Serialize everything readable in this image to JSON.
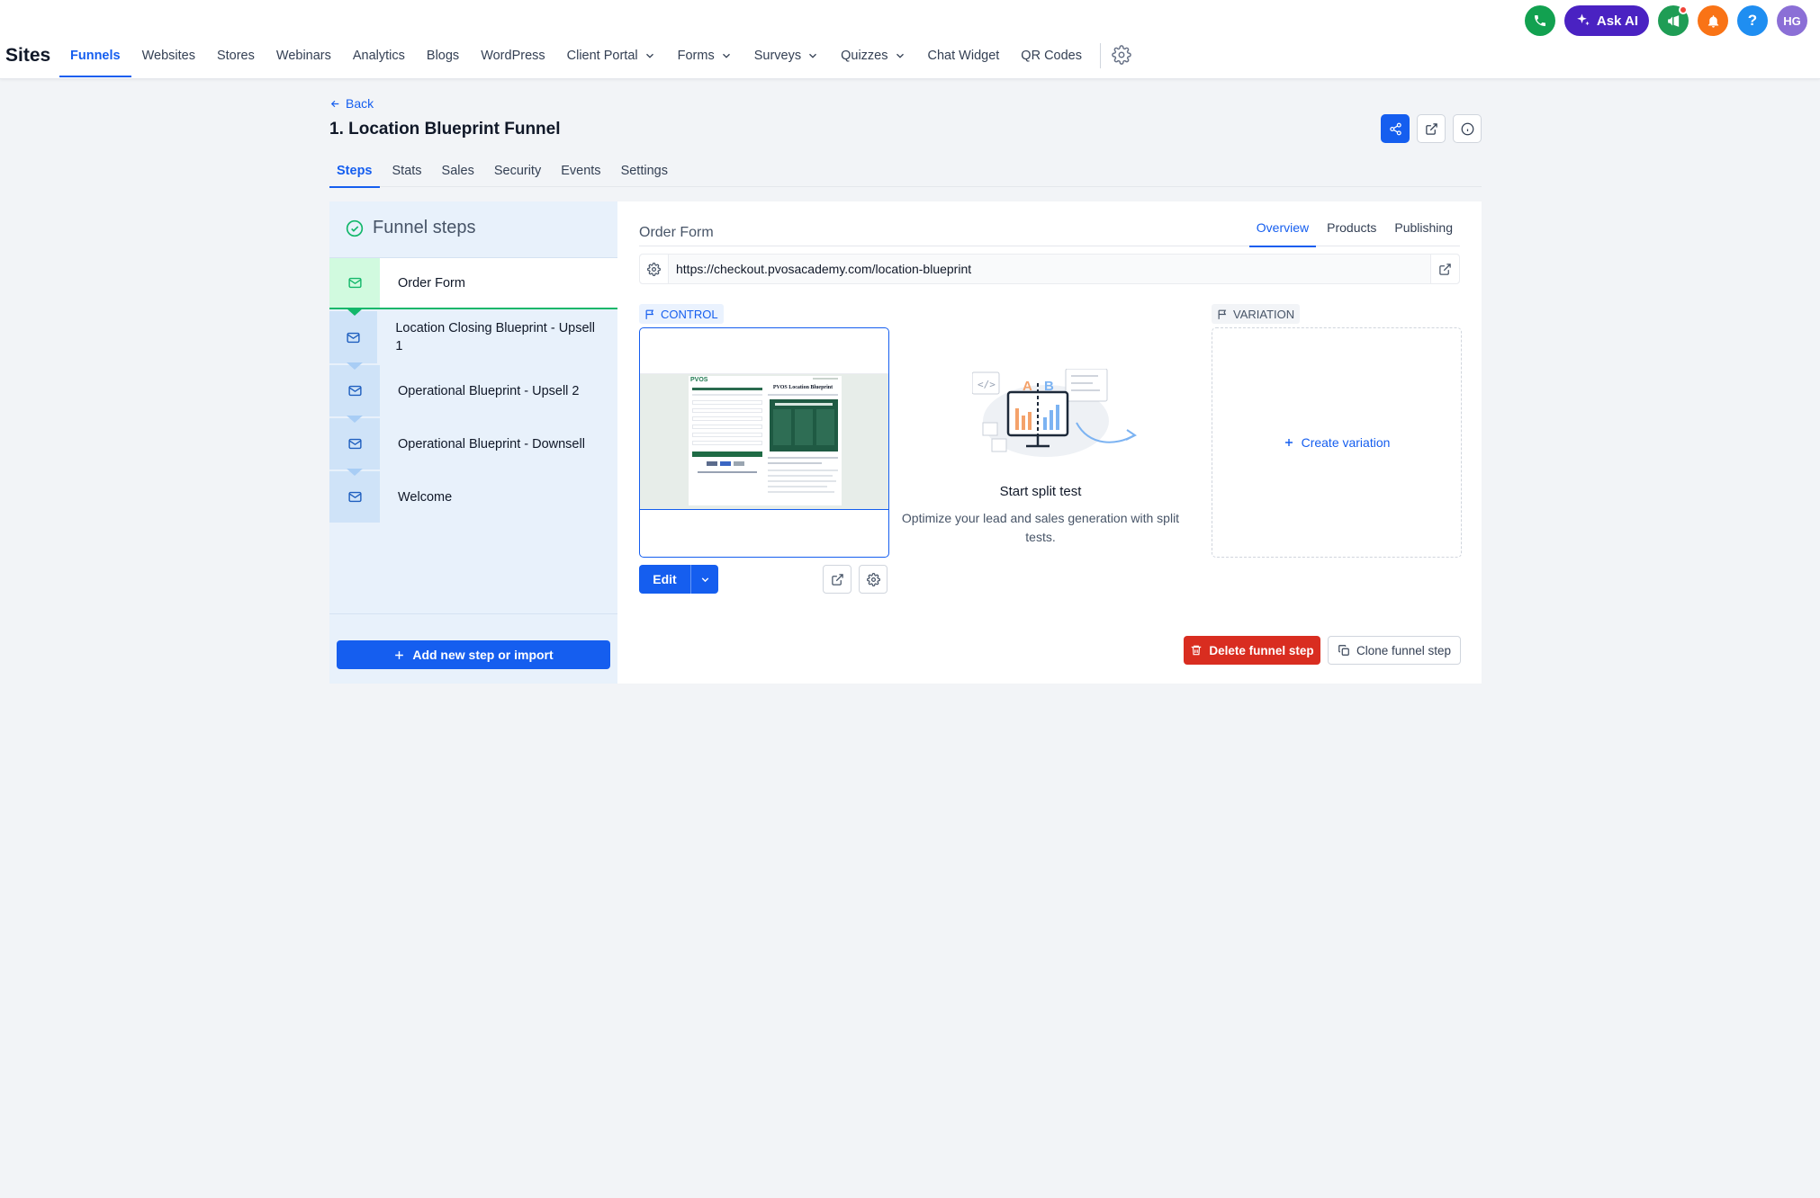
{
  "app": {
    "brand": "Sites",
    "nav": [
      {
        "label": "Funnels",
        "active": true,
        "dropdown": false
      },
      {
        "label": "Websites",
        "dropdown": false
      },
      {
        "label": "Stores",
        "dropdown": false
      },
      {
        "label": "Webinars",
        "dropdown": false
      },
      {
        "label": "Analytics",
        "dropdown": false
      },
      {
        "label": "Blogs",
        "dropdown": false
      },
      {
        "label": "WordPress",
        "dropdown": false
      },
      {
        "label": "Client Portal",
        "dropdown": true
      },
      {
        "label": "Forms",
        "dropdown": true
      },
      {
        "label": "Surveys",
        "dropdown": true
      },
      {
        "label": "Quizzes",
        "dropdown": true
      },
      {
        "label": "Chat Widget",
        "dropdown": false
      },
      {
        "label": "QR Codes",
        "dropdown": false
      }
    ],
    "ask_ai_label": "Ask AI",
    "avatar_initials": "HG",
    "colors": {
      "phone": "#12a150",
      "ask_ai": "#4a22c2",
      "announce": "#1f9d55",
      "notify": "#f97316",
      "help": "#1f8ef1",
      "avatar": "#8b6fd6",
      "primary": "#155eef",
      "danger": "#d92d20"
    }
  },
  "header": {
    "back_label": "Back",
    "title": "1. Location Blueprint Funnel",
    "tabs": [
      "Steps",
      "Stats",
      "Sales",
      "Security",
      "Events",
      "Settings"
    ],
    "active_tab": "Steps"
  },
  "funnel_steps": {
    "title": "Funnel steps",
    "steps": [
      {
        "label": "Order Form",
        "active": true
      },
      {
        "label": "Location Closing Blueprint - Upsell 1"
      },
      {
        "label": "Operational Blueprint - Upsell 2"
      },
      {
        "label": "Operational Blueprint - Downsell"
      },
      {
        "label": "Welcome"
      }
    ],
    "add_label": "Add new step or import"
  },
  "detail": {
    "step_name": "Order Form",
    "tabs": [
      "Overview",
      "Products",
      "Publishing"
    ],
    "active_tab": "Overview",
    "url": "https://checkout.pvosacademy.com/location-blueprint",
    "control_label": "CONTROL",
    "variation_label": "VARIATION",
    "edit_label": "Edit",
    "preview": {
      "logo": "PVOS",
      "headline": "PVOS Location Blueprint"
    },
    "split_title": "Start split test",
    "split_desc": "Optimize your lead and sales generation with split tests.",
    "split_letters": [
      "A",
      "B"
    ],
    "create_variation_label": "Create variation",
    "delete_label": "Delete funnel step",
    "clone_label": "Clone funnel step"
  }
}
